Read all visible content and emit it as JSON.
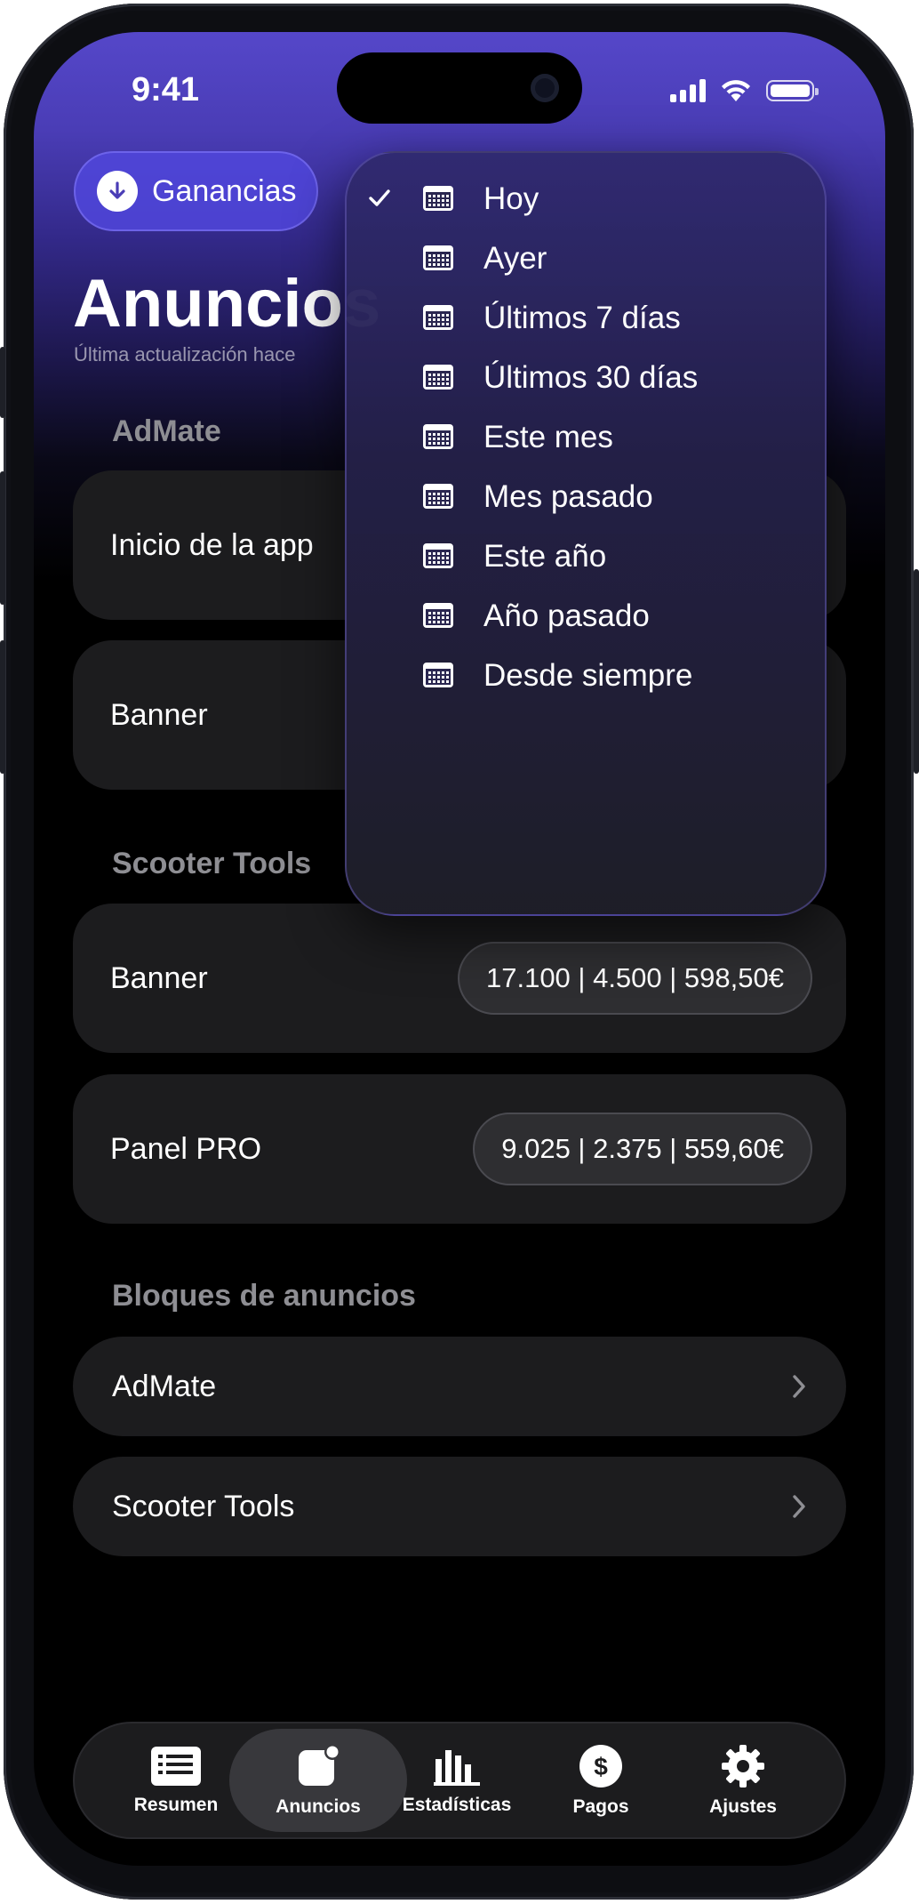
{
  "status_bar": {
    "time": "9:41"
  },
  "header": {
    "earnings_button_label": "Ganancias",
    "title": "Anuncios",
    "subtitle": "Última actualización hace"
  },
  "sections": [
    {
      "label": "AdMate",
      "rows": [
        {
          "label": "Inicio de la app"
        },
        {
          "label": "Banner"
        }
      ]
    },
    {
      "label": "Scooter Tools",
      "rows": [
        {
          "label": "Banner",
          "stats": "17.100 | 4.500 | 598,50€"
        },
        {
          "label": "Panel PRO",
          "stats": "9.025 | 2.375 | 559,60€"
        }
      ]
    },
    {
      "label": "Bloques de anuncios",
      "rows": [
        {
          "label": "AdMate"
        },
        {
          "label": "Scooter Tools"
        }
      ]
    }
  ],
  "date_menu": {
    "selected": "Hoy",
    "items": [
      {
        "label": "Hoy",
        "icon": "calendar-icon"
      },
      {
        "label": "Ayer",
        "icon": "calendar-icon"
      },
      {
        "label": "Últimos 7 días",
        "icon": "calendar-icon"
      },
      {
        "label": "Últimos 30 días",
        "icon": "calendar-icon"
      },
      {
        "label": "Este mes",
        "icon": "calendar-icon"
      },
      {
        "label": "Mes pasado",
        "icon": "calendar-icon"
      },
      {
        "label": "Este año",
        "icon": "calendar-icon"
      },
      {
        "label": "Año pasado",
        "icon": "calendar-icon"
      },
      {
        "label": "Desde siempre",
        "icon": "calendar-icon"
      }
    ]
  },
  "tab_bar": {
    "active": "Anuncios",
    "tabs": [
      {
        "label": "Resumen",
        "icon": "list-icon"
      },
      {
        "label": "Anuncios",
        "icon": "app-badge-icon"
      },
      {
        "label": "Estadísticas",
        "icon": "bar-chart-icon"
      },
      {
        "label": "Pagos",
        "icon": "dollar-circle-icon"
      },
      {
        "label": "Ajustes",
        "icon": "gear-icon"
      }
    ]
  },
  "colors": {
    "accent": "#5547c9",
    "card": "#1c1c1e",
    "section_label": "#8e8e93"
  }
}
